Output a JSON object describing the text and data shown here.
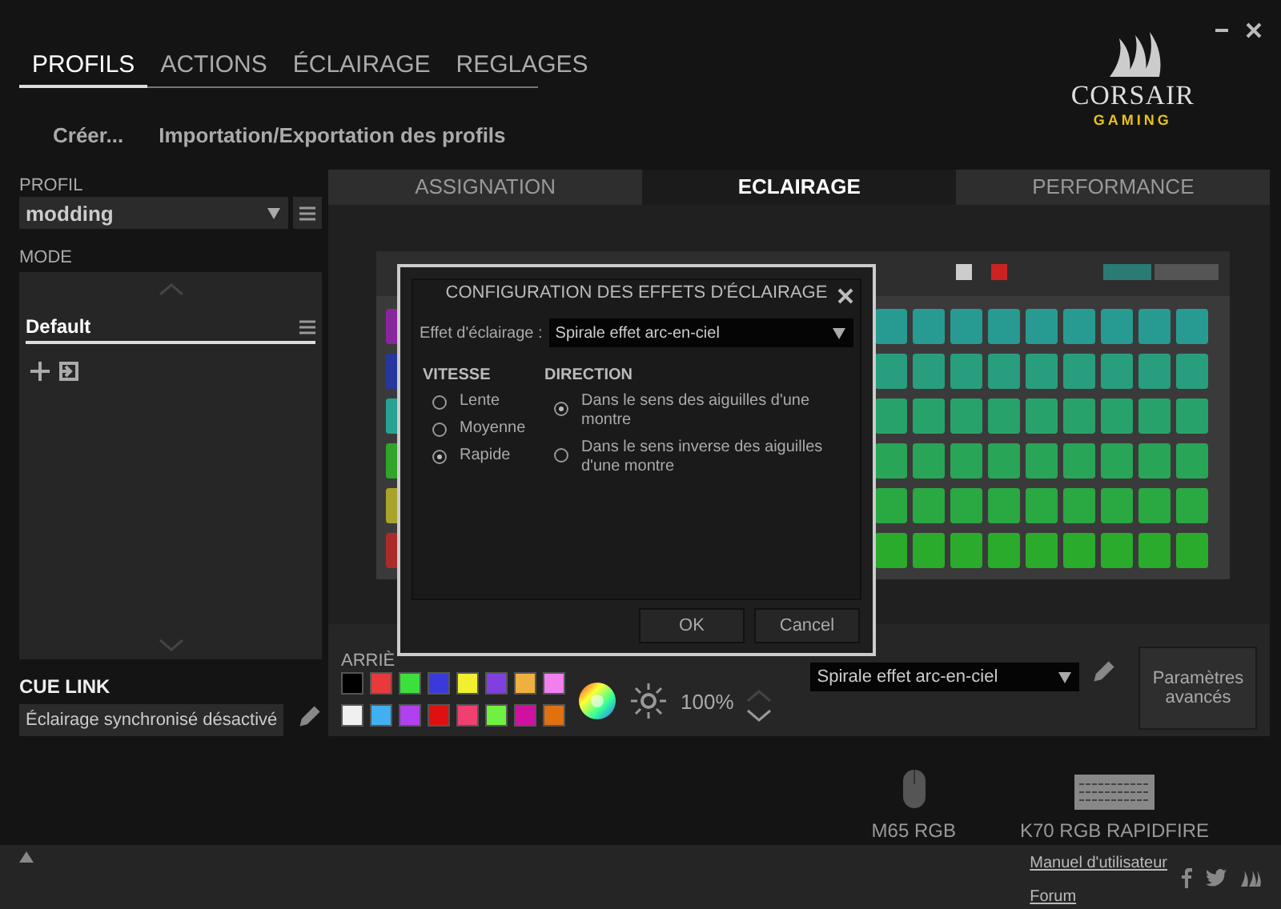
{
  "nav_tabs": [
    {
      "label": "PROFILS",
      "selected": true
    },
    {
      "label": "ACTIONS",
      "selected": false
    },
    {
      "label": "ÉCLAIRAGE",
      "selected": false
    },
    {
      "label": "REGLAGES",
      "selected": false
    }
  ],
  "sub_actions": [
    "Créer...",
    "Importation/Exportation des profils"
  ],
  "logo": {
    "brand": "CORSAIR",
    "tagline": "GAMING"
  },
  "sidebar": {
    "profile_label": "PROFIL",
    "profile": "modding",
    "mode_label": "MODE",
    "modes": [
      {
        "label": "Default",
        "selected": true
      }
    ],
    "cue_link_label": "CUE LINK",
    "cue_link": "Éclairage synchronisé désactivé"
  },
  "panel_tabs": [
    {
      "label": "ASSIGNATION",
      "selected": false
    },
    {
      "label": "ECLAIRAGE",
      "selected": true
    },
    {
      "label": "PERFORMANCE",
      "selected": false
    }
  ],
  "lighting": {
    "background_label": "ARRIÈ",
    "swatches": [
      {
        "color": "#000000"
      },
      {
        "color": "#e83a3a"
      },
      {
        "color": "#3be03b"
      },
      {
        "color": "#3a3adc"
      },
      {
        "color": "#f0f030"
      },
      {
        "color": "#8040e0"
      },
      {
        "color": "#f0b040"
      },
      {
        "color": "#f080f0"
      },
      {
        "color": "#f0f0f0"
      },
      {
        "color": "#40b0f0"
      },
      {
        "color": "#b040f0"
      },
      {
        "color": "#e01010"
      },
      {
        "color": "#f04070"
      },
      {
        "color": "#70f040"
      },
      {
        "color": "#d010a0"
      },
      {
        "color": "#e07010"
      }
    ],
    "brightness": "100%",
    "effect": "Spirale effet arc-en-ciel",
    "advanced_button": "Paramètres avancés"
  },
  "dialog": {
    "title": "CONFIGURATION DES EFFETS D'ÉCLAIRAGE",
    "effect_label": "Effet d'éclairage :",
    "effect": "Spirale effet arc-en-ciel",
    "speed_label": "VITESSE",
    "speeds": [
      {
        "label": "Lente",
        "selected": false
      },
      {
        "label": "Moyenne",
        "selected": false
      },
      {
        "label": "Rapide",
        "selected": true
      }
    ],
    "direction_label": "DIRECTION",
    "directions": [
      {
        "label": "Dans le sens des aiguilles d'une montre",
        "selected": true
      },
      {
        "label": "Dans le sens inverse des aiguilles d'une montre",
        "selected": false
      }
    ],
    "buttons": [
      "OK",
      "Cancel"
    ]
  },
  "devices": [
    {
      "name": "M65 RGB",
      "kind": "mouse"
    },
    {
      "name": "K70 RGB RAPIDFIRE",
      "kind": "keyboard"
    }
  ],
  "footer_links": [
    "Manuel d'utilisateur",
    "Forum"
  ]
}
